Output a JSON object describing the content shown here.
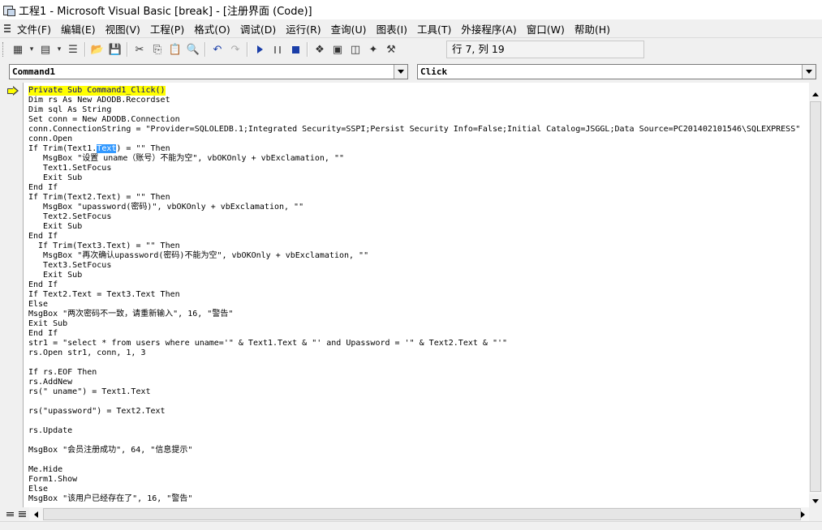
{
  "window": {
    "title": "工程1 - Microsoft Visual Basic [break] - [注册界面 (Code)]",
    "app_icon": "vb-project-icon"
  },
  "menu": [
    "文件(F)",
    "编辑(E)",
    "视图(V)",
    "工程(P)",
    "格式(O)",
    "调试(D)",
    "运行(R)",
    "查询(U)",
    "图表(I)",
    "工具(T)",
    "外接程序(A)",
    "窗口(W)",
    "帮助(H)"
  ],
  "toolbar": {
    "cursor_position": "行 7, 列 19",
    "icons": [
      "add-project-icon",
      "add-form-icon",
      "menu-editor-icon",
      "open-icon",
      "save-icon",
      "cut-icon",
      "copy-icon",
      "paste-icon",
      "find-icon",
      "undo-icon",
      "redo-icon",
      "run-icon",
      "pause-icon",
      "stop-icon",
      "project-explorer-icon",
      "properties-icon",
      "form-layout-icon",
      "object-browser-icon",
      "toolbox-icon"
    ]
  },
  "object_combo": "Command1",
  "procedure_combo": "Click",
  "code": {
    "l1": "Private Sub Command1_Click()",
    "l2": "Dim rs As New ADODB.Recordset",
    "l3": "Dim sql As String",
    "l4": "Set conn = New ADODB.Connection",
    "l5": "conn.ConnectionString = \"Provider=SQLOLEDB.1;Integrated Security=SSPI;Persist Security Info=False;Initial Catalog=JSGGL;Data Source=PC201402101546\\SQLEXPRESS\"",
    "l6": "conn.Open",
    "l7a": "If Trim(Text1.",
    "l7sel": "Text",
    "l7b": ") = \"\" Then",
    "l8": "   MsgBox \"设置 uname（账号）不能为空\", vbOKOnly + vbExclamation, \"\"",
    "l9": "   Text1.SetFocus",
    "l10": "   Exit Sub",
    "l11": "End If",
    "l12": "If Trim(Text2.Text) = \"\" Then",
    "l13": "   MsgBox \"upassword(密码)\", vbOKOnly + vbExclamation, \"\"",
    "l14": "   Text2.SetFocus",
    "l15": "   Exit Sub",
    "l16": "End If",
    "l17": "  If Trim(Text3.Text) = \"\" Then",
    "l18": "   MsgBox \"再次确认upassword(密码)不能为空\", vbOKOnly + vbExclamation, \"\"",
    "l19": "   Text3.SetFocus",
    "l20": "   Exit Sub",
    "l21": "End If",
    "l22": "If Text2.Text = Text3.Text Then",
    "l23": "Else",
    "l24": "MsgBox \"两次密码不一致，请重新输入\", 16, \"警告\"",
    "l25": "Exit Sub",
    "l26": "End If",
    "l27": "str1 = \"select * from users where uname='\" & Text1.Text & \"' and Upassword = '\" & Text2.Text & \"'\"",
    "l28": "rs.Open str1, conn, 1, 3",
    "l30": "If rs.EOF Then",
    "l31": "rs.AddNew",
    "l32": "rs(\" uname\") = Text1.Text",
    "l34": "rs(\"upassword\") = Text2.Text",
    "l36": "rs.Update",
    "l38": "MsgBox \"会员注册成功\", 64, \"信息提示\"",
    "l40": "Me.Hide",
    "l41": "Form1.Show",
    "l42": "Else",
    "l43": "MsgBox \"该用户已经存在了\", 16, \"警告\""
  }
}
